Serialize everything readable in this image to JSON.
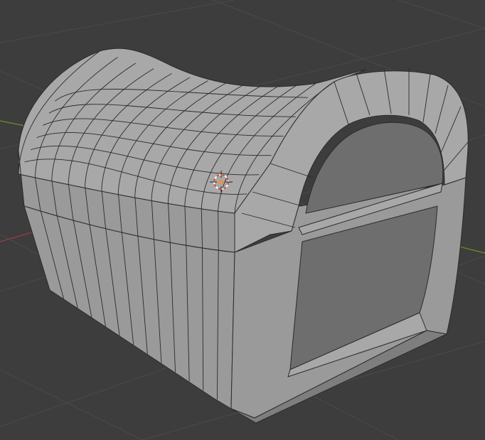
{
  "viewport": {
    "background_color": "#3d3d3d",
    "grid_line_color": "#4a4a4a",
    "x_axis_color": "#9b3b44",
    "y_axis_color": "#6b8f2c"
  },
  "mesh": {
    "object_type": "treasure-chest",
    "display_mode": "solid-with-wireframe",
    "face_light_color": "#a8a8a8",
    "face_mid_color": "#9a9a9a",
    "face_dark_color": "#7e7e7e",
    "inner_face_color": "#6e6e6e",
    "edge_color": "#2b2b2b"
  },
  "origin_marker": {
    "icon": "object-origin-icon",
    "color": "#e8933a"
  },
  "cursor_3d": {
    "icon": "3d-cursor-icon",
    "ring_color_a": "#d94a3a",
    "ring_color_b": "#ffffff"
  }
}
